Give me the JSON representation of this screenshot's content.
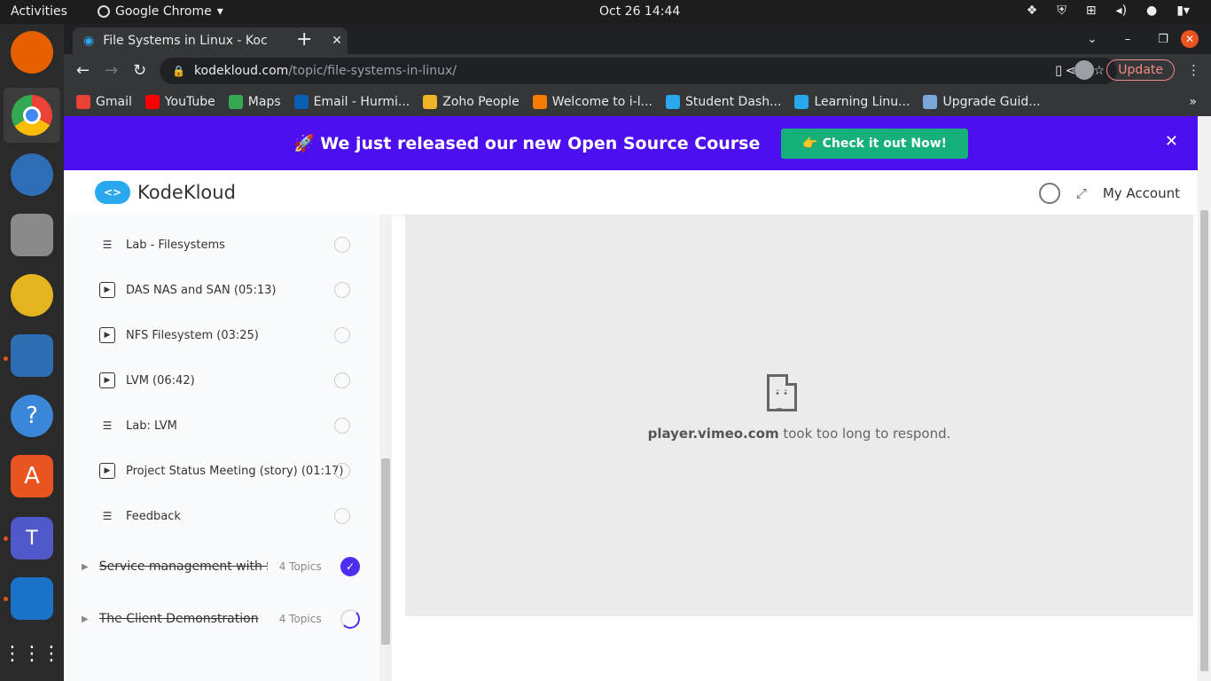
{
  "system": {
    "activities": "Activities",
    "app_name": "Google Chrome",
    "clock": "Oct 26  14:44"
  },
  "browser": {
    "tab_title": "File Systems in Linux - Koc",
    "url_host": "kodekloud.com",
    "url_path": "/topic/file-systems-in-linux/",
    "update_label": "Update",
    "bookmarks": [
      {
        "label": "Gmail",
        "color": "#ea4335"
      },
      {
        "label": "YouTube",
        "color": "#ff0000"
      },
      {
        "label": "Maps",
        "color": "#34a853"
      },
      {
        "label": "Email - Hurmi...",
        "color": "#0a5fb4"
      },
      {
        "label": "Zoho People",
        "color": "#f0b429"
      },
      {
        "label": "Welcome to i-l...",
        "color": "#f57c00"
      },
      {
        "label": "Student Dash...",
        "color": "#29a8f0"
      },
      {
        "label": "Learning Linu...",
        "color": "#29a8f0"
      },
      {
        "label": "Upgrade Guid...",
        "color": "#7aa7d8"
      }
    ]
  },
  "banner": {
    "message": "🚀 We just released our new Open Source Course",
    "cta": "👉 Check it out Now!"
  },
  "header": {
    "logo_text": "KodeKloud",
    "account": "My Account"
  },
  "sidebar": {
    "lessons": [
      {
        "label": "Lab - Filesystems",
        "type": "lab"
      },
      {
        "label": "DAS NAS and SAN (05:13)",
        "type": "video"
      },
      {
        "label": "NFS Filesystem (03:25)",
        "type": "video"
      },
      {
        "label": "LVM (06:42)",
        "type": "video"
      },
      {
        "label": "Lab: LVM",
        "type": "lab"
      },
      {
        "label": "Project Status Meeting (story) (01:17)",
        "type": "video"
      },
      {
        "label": "Feedback",
        "type": "lab"
      }
    ],
    "sections": [
      {
        "title": "Service management with S...",
        "count": "4 Topics",
        "status": "complete"
      },
      {
        "title": "The Client Demonstration",
        "count": "4 Topics",
        "status": "in-progress"
      }
    ]
  },
  "video": {
    "error_host": "player.vimeo.com",
    "error_text": " took too long to respond."
  },
  "colors": {
    "banner": "#4d0ff0",
    "cta": "#16b07a",
    "accent": "#4d2ef0"
  }
}
